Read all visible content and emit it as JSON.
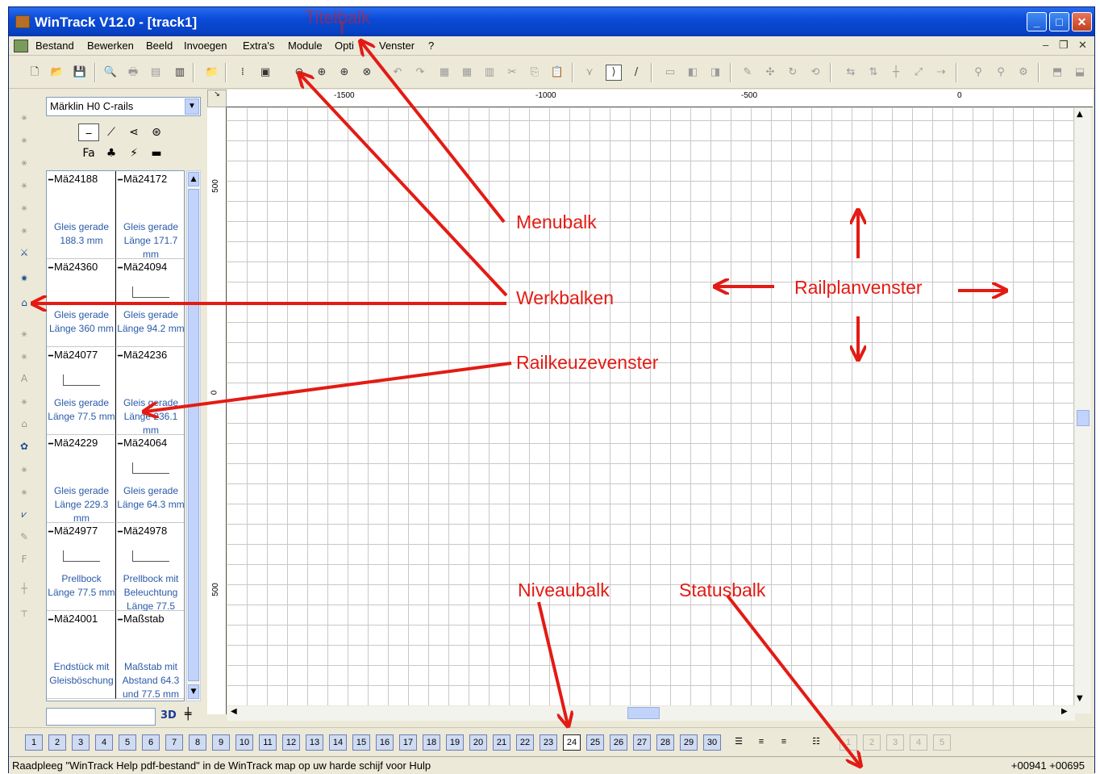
{
  "window": {
    "title": "WinTrack  V12.0 - [track1]",
    "buttons": {
      "minimize": "_",
      "maximize": "□",
      "close": "✕"
    }
  },
  "menubar": {
    "items": [
      "Bestand",
      "Bewerken",
      "Beeld",
      "Invoegen",
      "Extra's",
      "Module",
      "Opti",
      "Venster",
      "?"
    ],
    "mdi_buttons": {
      "minimize": "–",
      "restore": "❐",
      "close": "✕"
    }
  },
  "toolbar": {
    "icons": [
      "new-icon",
      "open-icon",
      "save-icon",
      "print-preview-icon",
      "print-icon",
      "page-setup-icon",
      "report-icon",
      "import-icon",
      "grid-icon",
      "background-icon",
      "zoom-out-icon",
      "zoom-in-icon",
      "zoom-window-icon",
      "zoom-all-icon",
      "undo-icon",
      "redo-icon",
      "copy-doc-icon",
      "paste-doc-icon",
      "cut-icon",
      "copy-icon",
      "paste-icon",
      "select-icon",
      "curve-icon",
      "line-icon"
    ]
  },
  "chooser": {
    "catalog": "Märklin H0 C-rails",
    "items": [
      {
        "article": "Mä24188",
        "desc": "Gleis gerade 188.3 mm"
      },
      {
        "article": "Mä24172",
        "desc": "Gleis gerade Länge 171.7 mm"
      },
      {
        "article": "Mä24360",
        "desc": "Gleis gerade Länge 360 mm"
      },
      {
        "article": "Mä24094",
        "desc": "Gleis gerade Länge 94.2 mm"
      },
      {
        "article": "Mä24077",
        "desc": "Gleis gerade Länge 77.5 mm"
      },
      {
        "article": "Mä24236",
        "desc": "Gleis gerade Länge 236.1 mm"
      },
      {
        "article": "Mä24229",
        "desc": "Gleis gerade Länge 229.3 mm"
      },
      {
        "article": "Mä24064",
        "desc": "Gleis gerade Länge 64.3 mm"
      },
      {
        "article": "Mä24977",
        "desc": "Prellbock Länge 77.5 mm"
      },
      {
        "article": "Mä24978",
        "desc": "Prellbock mit Beleuchtung Länge 77.5"
      },
      {
        "article": "Mä24001",
        "desc": "Endstück mit Gleisböschung"
      },
      {
        "article": "Maßstab",
        "desc": "Maßstab mit Abstand 64.3 und 77.5 mm"
      }
    ],
    "btn_3d": "3D"
  },
  "ruler": {
    "x_labels": [
      "-1500",
      "-1000",
      "-500",
      "0"
    ],
    "y_labels": [
      "500",
      "0",
      "500"
    ]
  },
  "levelbar": {
    "levels": [
      "1",
      "2",
      "3",
      "4",
      "5",
      "6",
      "7",
      "8",
      "9",
      "10",
      "11",
      "12",
      "13",
      "14",
      "15",
      "16",
      "17",
      "18",
      "19",
      "20",
      "21",
      "22",
      "23",
      "24",
      "25",
      "26",
      "27",
      "28",
      "29",
      "30"
    ],
    "current": "24",
    "extra_levels": [
      "1",
      "2",
      "3",
      "4",
      "5"
    ]
  },
  "statusbar": {
    "message": "Raadpleeg \"WinTrack Help pdf-bestand\" in de WinTrack map op uw harde schijf voor Hulp",
    "coords": "+00941 +00695"
  },
  "annotations": {
    "titelbalk": "Titelbalk",
    "menubalk": "Menubalk",
    "werkbalken": "Werkbalken",
    "railkeuzevenster": "Railkeuzevenster",
    "railplanvenster": "Railplanvenster",
    "niveaubalk": "Niveaubalk",
    "statusbalk": "Statusbalk",
    "color": "#e31b14"
  },
  "colors": {
    "titlebar": "#0a4bd8",
    "chrome": "#ece9d8",
    "link_text": "#2a5aa8"
  }
}
